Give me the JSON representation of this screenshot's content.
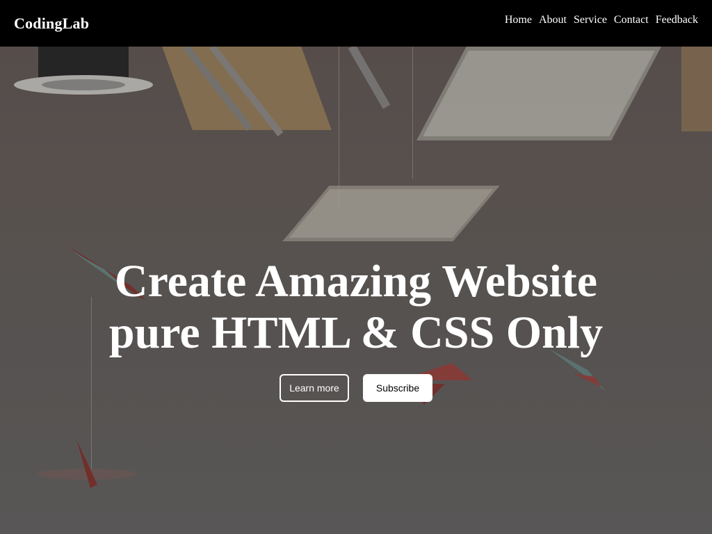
{
  "header": {
    "logo": "CodingLab",
    "nav": [
      {
        "label": "Home"
      },
      {
        "label": "About"
      },
      {
        "label": "Service"
      },
      {
        "label": "Contact"
      },
      {
        "label": "Feedback"
      }
    ]
  },
  "hero": {
    "title_line1": "Create Amazing Website",
    "title_line2": "pure HTML & CSS Only",
    "learn_more_label": "Learn more",
    "subscribe_label": "Subscribe"
  },
  "colors": {
    "navbar_bg": "#000000",
    "text": "#ffffff",
    "button_solid_bg": "#ffffff"
  }
}
